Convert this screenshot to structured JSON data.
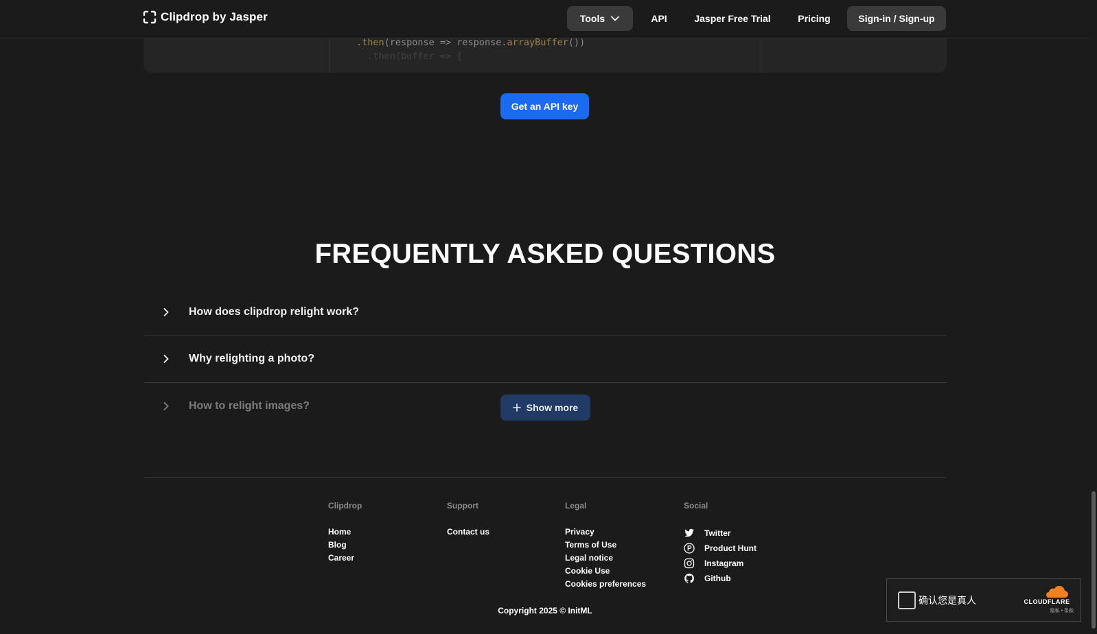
{
  "brand": {
    "name": "Clipdrop by Jasper"
  },
  "nav": {
    "tools_label": "Tools",
    "api_label": "API",
    "trial_label": "Jasper Free Trial",
    "pricing_label": "Pricing",
    "signin_label": "Sign-in / Sign-up"
  },
  "code": {
    "line1_method": ".then",
    "line1_rest_a": "(response => response.",
    "line1_call": "arrayBuffer",
    "line1_rest_b": "())",
    "line2": "  .then(buffer => {"
  },
  "cta": {
    "api_key_label": "Get an API key"
  },
  "faq": {
    "title": "FREQUENTLY ASKED QUESTIONS",
    "items": [
      {
        "question": "How does clipdrop relight work?"
      },
      {
        "question": "Why relighting a photo?"
      },
      {
        "question": "How to relight images?"
      }
    ],
    "show_more_label": "Show more"
  },
  "footer": {
    "columns": [
      {
        "heading": "Clipdrop",
        "links": [
          "Home",
          "Blog",
          "Career"
        ]
      },
      {
        "heading": "Support",
        "links": [
          "Contact us"
        ]
      },
      {
        "heading": "Legal",
        "links": [
          "Privacy",
          "Terms of Use",
          "Legal notice",
          "Cookie Use",
          "Cookies preferences"
        ]
      },
      {
        "heading": "Social",
        "links": [
          "Twitter",
          "Product Hunt",
          "Instagram",
          "Github"
        ]
      }
    ],
    "social_icons": [
      "twitter-icon",
      "product-hunt-icon",
      "instagram-icon",
      "github-icon"
    ],
    "copyright": "Copyright 2025 © InitML"
  },
  "captcha": {
    "label": "确认您是真人",
    "provider": "CLOUDFLARE",
    "links": "隐私 • 条款"
  },
  "colors": {
    "background": "#1b1b1b",
    "primary_button": "#1a6af2",
    "show_more_button": "#213a66",
    "cloudflare_orange": "#f48120"
  }
}
